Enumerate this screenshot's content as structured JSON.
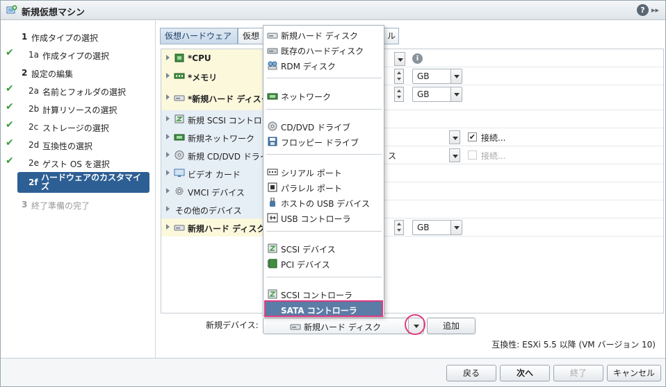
{
  "window": {
    "title": "新規仮想マシン",
    "help": "?",
    "expand": "▸▸"
  },
  "nav": {
    "steps": [
      {
        "num": "1",
        "label": "作成タイプの選択"
      },
      {
        "num": "1a",
        "label": "作成タイプの選択"
      },
      {
        "num": "2",
        "label": "設定の編集"
      },
      {
        "num": "2a",
        "label": "名前とフォルダの選択"
      },
      {
        "num": "2b",
        "label": "計算リソースの選択"
      },
      {
        "num": "2c",
        "label": "ストレージの選択"
      },
      {
        "num": "2d",
        "label": "互換性の選択"
      },
      {
        "num": "2e",
        "label": "ゲスト OS を選択"
      },
      {
        "num": "2f",
        "label": "ハードウェアのカスタマイズ"
      },
      {
        "num": "3",
        "label": "終了準備の完了"
      }
    ],
    "check": "✔"
  },
  "tabs": [
    {
      "label": "仮想ハードウェア"
    },
    {
      "label": "仮想"
    },
    {
      "label": "ル"
    }
  ],
  "hardware": {
    "rows": [
      {
        "name": "*CPU"
      },
      {
        "name": "*メモリ"
      },
      {
        "name": "*新規ハード ディスク"
      },
      {
        "name": "新規 SCSI コントロー"
      },
      {
        "name": "新規ネットワーク"
      },
      {
        "name": "新規 CD/DVD ドライ"
      },
      {
        "name": "ビデオ カード"
      },
      {
        "name": "VMCI デバイス"
      },
      {
        "name": "その他のデバイス"
      },
      {
        "name": "新規ハード ディスク"
      }
    ],
    "memory_unit": "GB",
    "disk_unit": "GB",
    "disk2_unit": "GB",
    "cd_value_fragment": "ス",
    "network_connect_label": "接続...",
    "cd_connect_label": "接続...",
    "network_connect_checked": "✔",
    "info": "i"
  },
  "menu": {
    "items": [
      {
        "label": "新規ハード ディスク"
      },
      {
        "label": "既存のハードディスク"
      },
      {
        "label": "RDM ディスク"
      },
      {
        "label": "ネットワーク"
      },
      {
        "label": "CD/DVD ドライブ"
      },
      {
        "label": "フロッピー ドライブ"
      },
      {
        "label": "シリアル ポート"
      },
      {
        "label": "パラレル ポート"
      },
      {
        "label": "ホストの USB デバイス"
      },
      {
        "label": "USB コントローラ"
      },
      {
        "label": "SCSI デバイス"
      },
      {
        "label": "PCI デバイス"
      },
      {
        "label": "SCSI コントローラ"
      },
      {
        "label": "SATA コントローラ"
      }
    ]
  },
  "new_device": {
    "label": "新規デバイス:",
    "selected": "新規ハード ディスク",
    "add_button": "追加"
  },
  "compatibility": "互換性: ESXi 5.5 以降 (VM バージョン 10)",
  "footer": {
    "back": "戻る",
    "next": "次へ",
    "finish": "終了",
    "cancel": "キャンセル"
  },
  "colors": {
    "active_step": "#2d5f94",
    "highlight": "#e03a80",
    "selected_menu": "#5a7ca6",
    "check": "#3a9b3a"
  }
}
